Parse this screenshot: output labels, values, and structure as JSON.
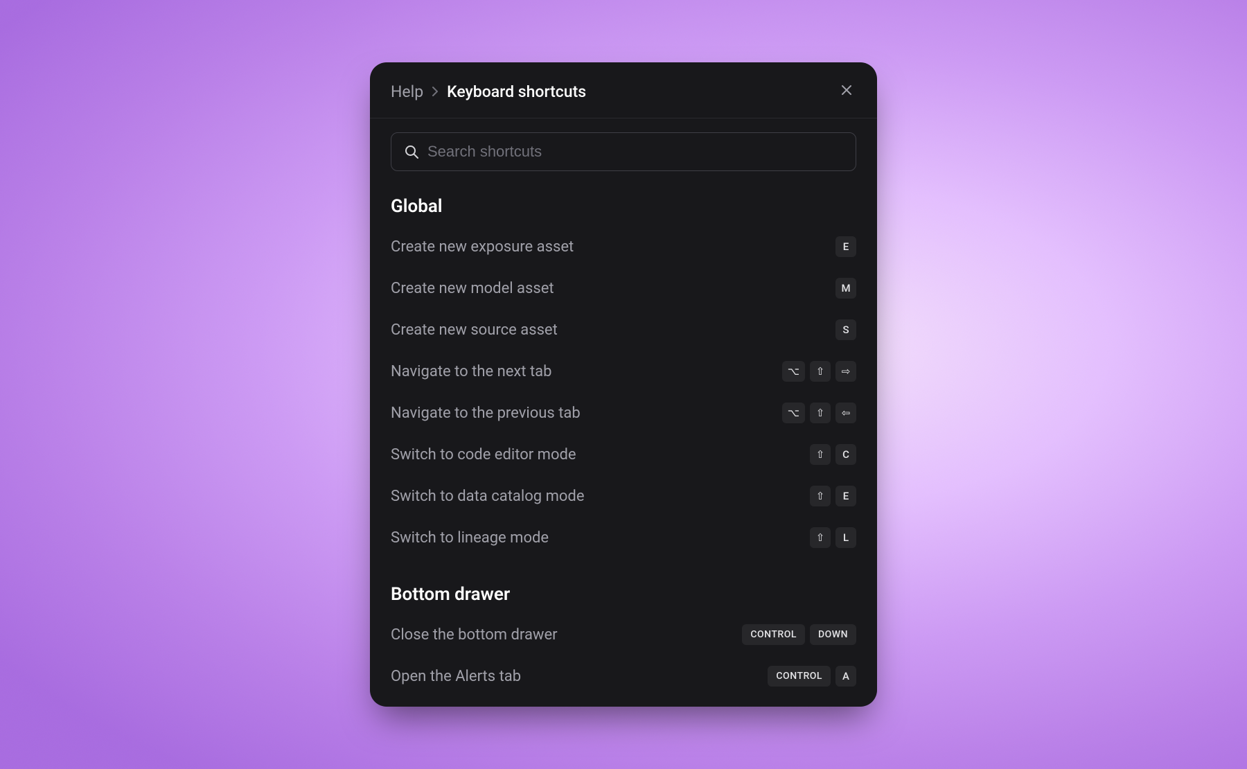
{
  "breadcrumb": {
    "help": "Help",
    "title": "Keyboard shortcuts"
  },
  "search": {
    "placeholder": "Search shortcuts"
  },
  "sections": [
    {
      "title": "Global",
      "items": [
        {
          "label": "Create new exposure asset",
          "keys": [
            "E"
          ]
        },
        {
          "label": "Create new model asset",
          "keys": [
            "M"
          ]
        },
        {
          "label": "Create new source asset",
          "keys": [
            "S"
          ]
        },
        {
          "label": "Navigate to the next tab",
          "keys": [
            "⌥",
            "⇧",
            "⇨"
          ]
        },
        {
          "label": "Navigate to the previous tab",
          "keys": [
            "⌥",
            "⇧",
            "⇦"
          ]
        },
        {
          "label": "Switch to code editor mode",
          "keys": [
            "⇧",
            "C"
          ]
        },
        {
          "label": "Switch to data catalog mode",
          "keys": [
            "⇧",
            "E"
          ]
        },
        {
          "label": "Switch to lineage mode",
          "keys": [
            "⇧",
            "L"
          ]
        }
      ]
    },
    {
      "title": "Bottom drawer",
      "items": [
        {
          "label": "Close the bottom drawer",
          "keys": [
            "CONTROL",
            "DOWN"
          ]
        },
        {
          "label": "Open the Alerts tab",
          "keys": [
            "CONTROL",
            "A"
          ]
        }
      ]
    }
  ]
}
